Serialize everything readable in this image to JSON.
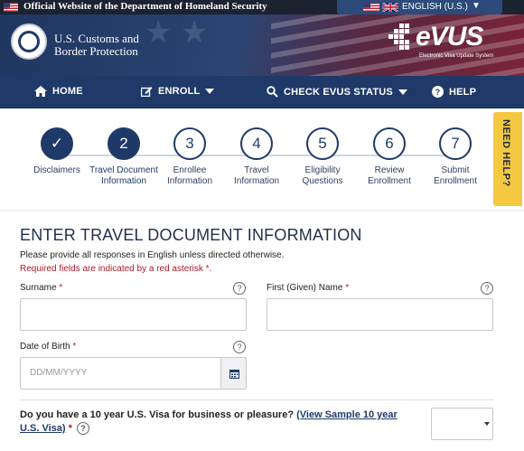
{
  "topbar": {
    "official_text": "Official Website of the Department of Homeland Security",
    "flag_icon": "us-flag-icon",
    "language": {
      "label": "ENGLISH (U.S.)",
      "caret": "▼",
      "flags": [
        "us-flag-icon",
        "uk-flag-icon"
      ]
    }
  },
  "header": {
    "agency_line1": "U.S. Customs and",
    "agency_line2": "Border Protection",
    "seal_icon": "dhs-seal-icon",
    "logo_name": "eVUS",
    "logo_subtitle": "Electronic Visa Update System",
    "colors": {
      "navy": "#1f3a68",
      "crimson": "#7a2438"
    }
  },
  "nav": {
    "items": [
      {
        "label": "HOME",
        "icon": "home-icon"
      },
      {
        "label": "ENROLL",
        "icon": "edit-icon",
        "dropdown": true
      },
      {
        "label": "CHECK EVUS STATUS",
        "icon": "search-icon",
        "dropdown": true
      },
      {
        "label": "HELP",
        "icon": "help-circle-icon"
      }
    ]
  },
  "stepper": {
    "steps": [
      {
        "number": "✓",
        "label": "Disclaimers",
        "state": "done"
      },
      {
        "number": "2",
        "label": "Travel Document Information",
        "state": "current"
      },
      {
        "number": "3",
        "label": "Enrollee Information",
        "state": "todo"
      },
      {
        "number": "4",
        "label": "Travel Information",
        "state": "todo"
      },
      {
        "number": "5",
        "label": "Eligibility Questions",
        "state": "todo"
      },
      {
        "number": "6",
        "label": "Review Enrollment",
        "state": "todo"
      },
      {
        "number": "7",
        "label": "Submit Enrollment",
        "state": "todo"
      }
    ],
    "need_help": "NEED HELP?",
    "need_help_color": "#f5c842"
  },
  "form": {
    "title": "ENTER TRAVEL DOCUMENT INFORMATION",
    "intro": "Please provide all responses in English unless directed otherwise.",
    "required_note": "Required fields are indicated by a red asterisk *.",
    "surname_label": "Surname",
    "first_name_label": "First (Given) Name",
    "dob_label": "Date of Birth",
    "dob_placeholder": "DD/MM/YYYY",
    "asterisk": "*",
    "help_mark": "?",
    "visa_question": "Do you have a 10 year U.S. Visa for business or pleasure?",
    "visa_link_open": "(View Sample 10 year",
    "visa_link_close": "U.S. Visa)",
    "visa_select_value": ""
  }
}
